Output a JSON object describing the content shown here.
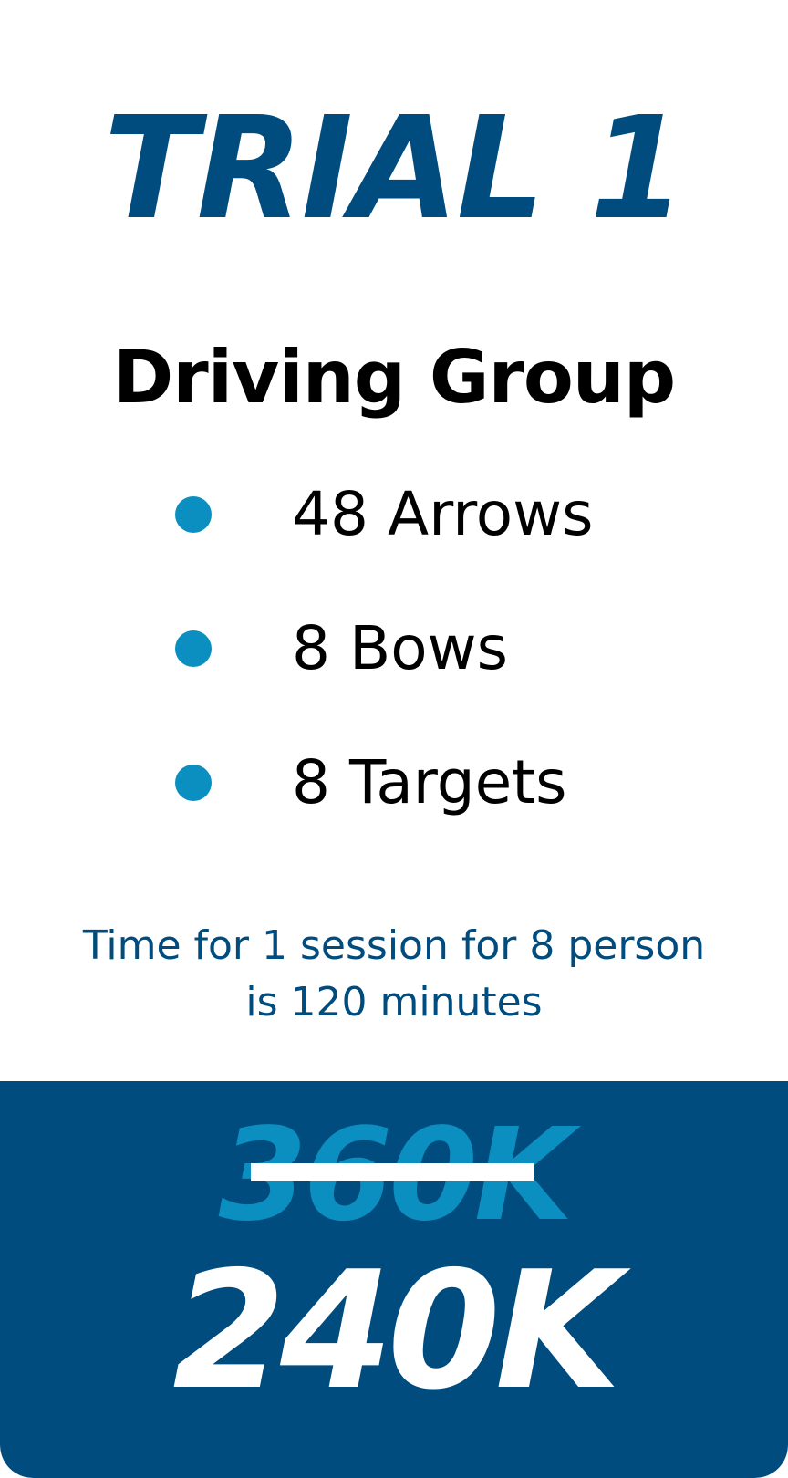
{
  "title": "TRIAL 1",
  "group": "Driving Group",
  "features": [
    {
      "label": "48 Arrows"
    },
    {
      "label": "8 Bows"
    },
    {
      "label": "8 Targets"
    }
  ],
  "time_note": {
    "line1": "Time for 1 session for 8 person",
    "line2": "is 120 minutes"
  },
  "price": {
    "original": "360K",
    "current": "240K"
  },
  "colors": {
    "primary": "#004c7e",
    "accent": "#0a8fc0",
    "text": "#000000",
    "background": "#ffffff"
  }
}
